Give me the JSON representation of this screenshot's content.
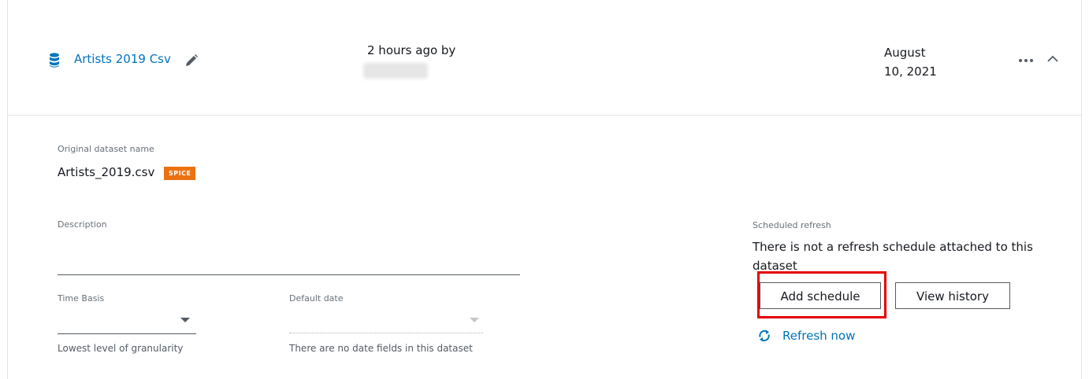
{
  "dataset": {
    "title": "Artists 2019 Csv",
    "updated": "2 hours ago by",
    "created_date": "August 10, 2021"
  },
  "details": {
    "original_name_label": "Original dataset name",
    "original_name": "Artists_2019.csv",
    "badge": "SPICE",
    "description_label": "Description",
    "description_value": "",
    "time_basis_label": "Time Basis",
    "time_basis_value": "",
    "time_basis_helper": "Lowest level of granularity",
    "default_date_label": "Default date",
    "default_date_value": "",
    "default_date_helper": "There are no date fields in this dataset"
  },
  "schedule": {
    "label": "Scheduled refresh",
    "message": "There is not a refresh schedule attached to this dataset",
    "add_button": "Add schedule",
    "history_button": "View history",
    "refresh_link": "Refresh now"
  },
  "colors": {
    "link": "#0073bb",
    "badge": "#ec7211",
    "highlight": "#e50000"
  },
  "icons": {
    "dataset": "database-icon",
    "edit": "pencil-icon",
    "more": "ellipsis-icon",
    "collapse": "chevron-up-icon",
    "refresh": "refresh-icon"
  }
}
